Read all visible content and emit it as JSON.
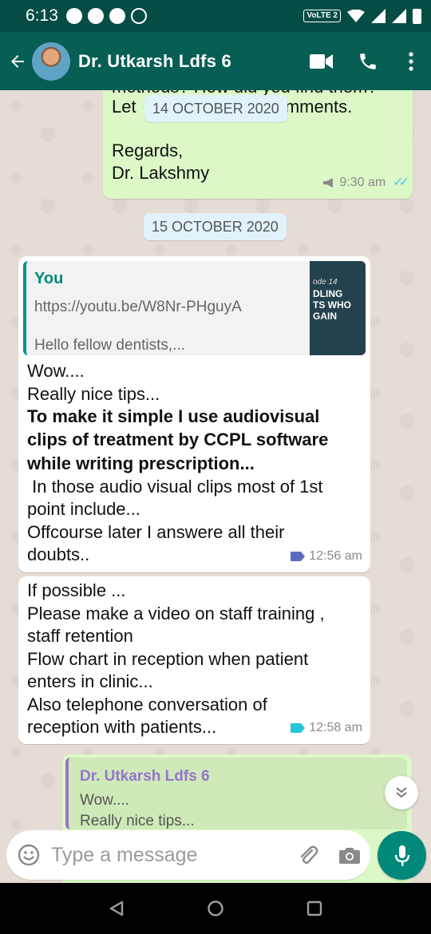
{
  "status_bar": {
    "time": "6:13",
    "network": "VoLTE 2"
  },
  "header": {
    "contact_name": "Dr. Utkarsh Ldfs 6"
  },
  "colors": {
    "header": "#075e54",
    "status_bar": "#054d44",
    "outgoing_bubble": "#dcf8c6",
    "incoming_bubble": "#ffffff",
    "accent": "#00897b",
    "read_ticks": "#4fc3f7"
  },
  "messages": {
    "m1": {
      "partial_top": "methods? How did you find them?",
      "line1_start": "Let",
      "line1_end": "omments.",
      "line2": "Regards,",
      "line3": "Dr. Lakshmy",
      "time": "9:30 am"
    },
    "date_overlay": "14 OCTOBER 2020",
    "date_chip": "15 OCTOBER 2020",
    "m2": {
      "quote_name": "You",
      "quote_link": "https://youtu.be/W8Nr-PHguyA",
      "quote_text": "Hello fellow dentists,...",
      "thumb_ep": "ode 14",
      "thumb_l1": "DLING",
      "thumb_l2": "TS WHO",
      "thumb_l3": "GAIN",
      "line1": "Wow....",
      "line2": "Really nice tips...",
      "bold1": "To make it simple I use audiovisual",
      "bold2": "clips of treatment by CCPL software",
      "bold3": "while writing prescription...",
      "line3": " In those audio visual clips most of 1st",
      "line4": "point include...",
      "line5": "Offcourse later I answere all their",
      "line6": "doubts..",
      "time": "12:56 am"
    },
    "m3": {
      "line1": "If possible ...",
      "line2": "Please make a video on staff training ,",
      "line3": "staff retention",
      "line4": "Flow chart in reception when patient",
      "line5": "enters in clinic...",
      "line6": "Also telephone conversation of",
      "line7": "reception with patients...",
      "time": "12:58 am"
    },
    "m4": {
      "quote_name": "Dr. Utkarsh Ldfs 6",
      "quote_line1": "Wow....",
      "quote_line2": "Really nice tips..."
    }
  },
  "composer": {
    "placeholder": "Type a message"
  },
  "icons": [
    "back-arrow-icon",
    "video-call-icon",
    "phone-icon",
    "more-vert-icon",
    "emoji-icon",
    "attach-icon",
    "camera-icon",
    "mic-icon",
    "chevron-down-icon",
    "nav-back-icon",
    "nav-home-icon",
    "nav-recents-icon"
  ]
}
